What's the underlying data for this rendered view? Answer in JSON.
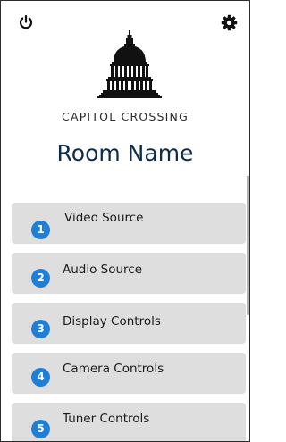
{
  "header": {
    "power_icon": "power-icon",
    "settings_icon": "gear-icon"
  },
  "logo": {
    "icon": "capitol-dome-icon",
    "brand_text": "CAPITOL CROSSING"
  },
  "room": {
    "name": "Room Name"
  },
  "menu": {
    "items": [
      {
        "number": "1",
        "label": "Video Source"
      },
      {
        "number": "2",
        "label": "Audio Source"
      },
      {
        "number": "3",
        "label": "Display Controls"
      },
      {
        "number": "4",
        "label": "Camera Controls"
      },
      {
        "number": "5",
        "label": "Tuner Controls"
      }
    ]
  },
  "colors": {
    "badge": "#1f7ed6",
    "room_name": "#0c2a4a",
    "item_background": "#dedede"
  }
}
